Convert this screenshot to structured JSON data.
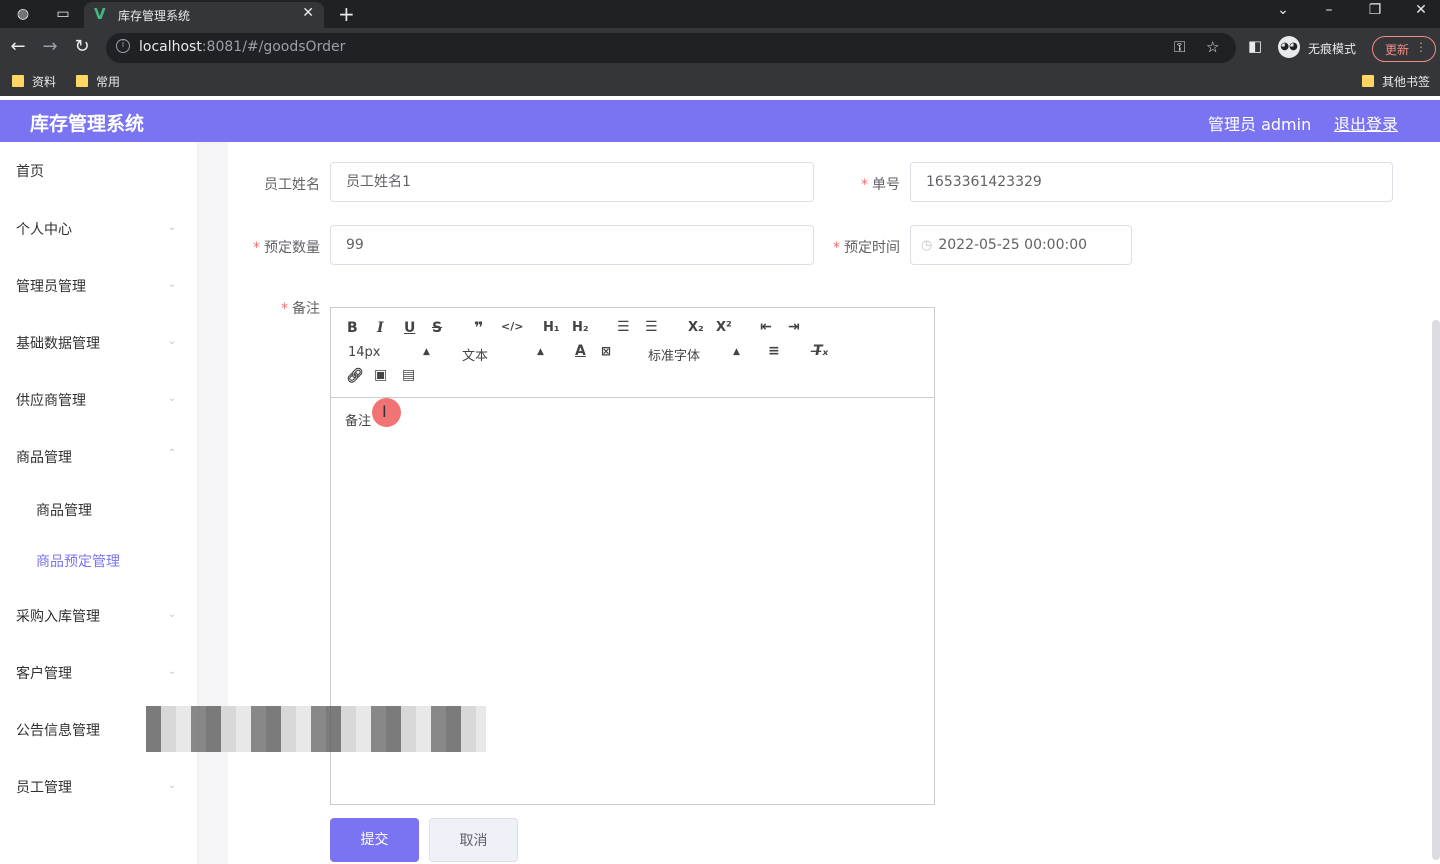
{
  "browser": {
    "tab_title": "库存管理系统",
    "url_host": "localhost",
    "url_rest": ":8081/#/goodsOrder",
    "profile_label": "无痕模式",
    "update_label": "更新",
    "bookmarks": [
      "资料",
      "常用"
    ],
    "other_bookmarks": "其他书签"
  },
  "header": {
    "title": "库存管理系统",
    "user": "管理员 admin",
    "logout": "退出登录"
  },
  "sidebar": {
    "items": [
      {
        "label": "首页"
      },
      {
        "label": "个人中心"
      },
      {
        "label": "管理员管理"
      },
      {
        "label": "基础数据管理"
      },
      {
        "label": "供应商管理"
      },
      {
        "label": "商品管理"
      },
      {
        "label": "采购入库管理"
      },
      {
        "label": "客户管理"
      },
      {
        "label": "公告信息管理"
      },
      {
        "label": "员工管理"
      }
    ],
    "subitems": [
      {
        "label": "商品管理"
      },
      {
        "label": "商品预定管理"
      }
    ]
  },
  "form": {
    "employee_name_label": "员工姓名",
    "employee_name_value": "员工姓名1",
    "order_no_label": "单号",
    "order_no_value": "1653361423329",
    "quantity_label": "预定数量",
    "quantity_value": "99",
    "time_label": "预定时间",
    "time_value": "2022-05-25 00:00:00",
    "remark_label": "备注",
    "remark_value": "备注"
  },
  "editor": {
    "font_size": "14px",
    "text_type": "文本",
    "font_family": "标准字体"
  },
  "buttons": {
    "submit": "提交",
    "cancel": "取消"
  },
  "colors": {
    "accent": "#7b74f2",
    "required": "#f56c6c"
  }
}
